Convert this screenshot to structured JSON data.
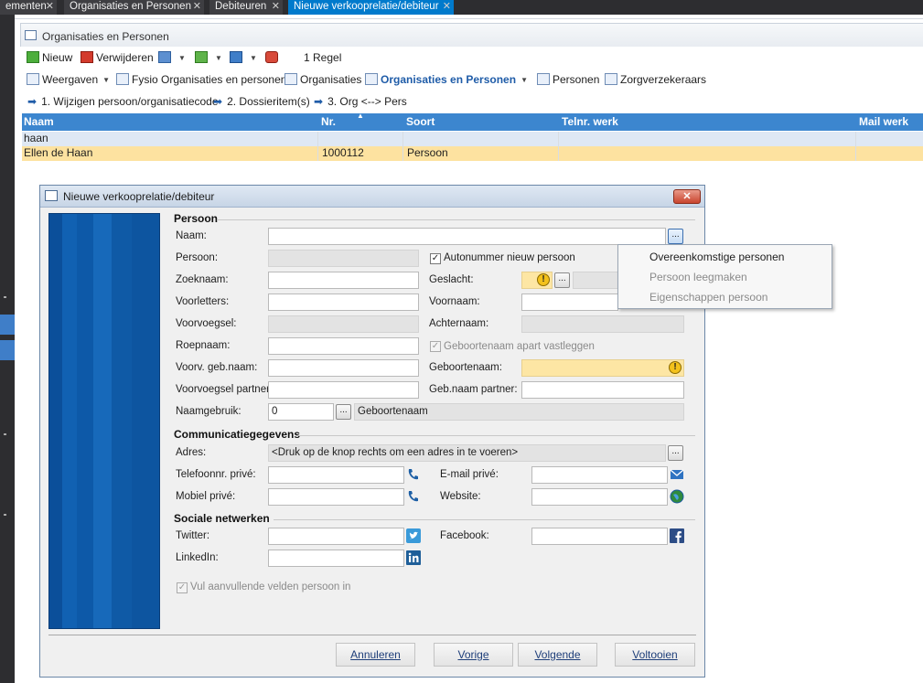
{
  "tabs": [
    {
      "label": "ementen"
    },
    {
      "label": "Organisaties en Personen"
    },
    {
      "label": "Debiteuren"
    },
    {
      "label": "Nieuwe verkooprelatie/debiteur",
      "active": true
    }
  ],
  "panel": {
    "title": "Organisaties en Personen",
    "toolbar1": {
      "new": "Nieuw",
      "delete": "Verwijderen",
      "count": "1 Regel"
    },
    "toolbar2": {
      "views": "Weergaven",
      "fysio": "Fysio  Organisaties en personen",
      "organisaties": "Organisaties",
      "org_personen": "Organisaties en Personen",
      "personen": "Personen",
      "zorg": "Zorgverzekeraars"
    },
    "toolbar3": {
      "action1": "1. Wijzigen persoon/organisatiecode",
      "action2": "2. Dossieritem(s)",
      "action3": "3. Org <--> Pers"
    }
  },
  "grid": {
    "columns": [
      "Naam",
      "Nr.",
      "Soort",
      "Telnr. werk",
      "Mail werk"
    ],
    "filter_row": [
      "haan",
      "",
      "",
      "",
      ""
    ],
    "rows": [
      [
        "Ellen de Haan",
        "1000112",
        "Persoon",
        "",
        ""
      ]
    ]
  },
  "dialog": {
    "title": "Nieuwe verkooprelatie/debiteur",
    "persoon_section": "Persoon",
    "labels": {
      "naam": "Naam:",
      "persoon": "Persoon:",
      "zoeknaam": "Zoeknaam:",
      "voorletters": "Voorletters:",
      "voorvoegsel": "Voorvoegsel:",
      "roepnaam": "Roepnaam:",
      "voorv_geb": "Voorv. geb.naam:",
      "voorv_partner": "Voorvoegsel partner:",
      "naamgebruik": "Naamgebruik:",
      "autonummer": "Autonummer nieuw persoon",
      "geslacht": "Geslacht:",
      "voornaam": "Voornaam:",
      "achternaam": "Achternaam:",
      "geb_apart": "Geboortenaam apart vastleggen",
      "geboortenaam": "Geboortenaam:",
      "geb_partner": "Geb.naam partner:"
    },
    "values": {
      "naamgebruik": "0",
      "naamgebruik_desc": "Geboortenaam"
    },
    "comm_section": "Communicatiegegevens",
    "comm": {
      "adres": "Adres:",
      "adres_placeholder": "<Druk op de knop rechts om een adres in te voeren>",
      "tel_prive": "Telefoonnr. privé:",
      "mobiel": "Mobiel privé:",
      "email": "E-mail privé:",
      "website": "Website:"
    },
    "social_section": "Sociale netwerken",
    "social": {
      "twitter": "Twitter:",
      "facebook": "Facebook:",
      "linkedin": "LinkedIn:"
    },
    "extra_checkbox": "Vul aanvullende velden persoon in",
    "buttons": {
      "annuleren": "Annuleren",
      "vorige": "Vorige",
      "volgende": "Volgende",
      "voltooien": "Voltooien"
    }
  },
  "context_menu": {
    "items": [
      {
        "label": "Overeenkomstige personen",
        "enabled": true
      },
      {
        "label": "Persoon leegmaken",
        "enabled": false
      },
      {
        "label": "Eigenschappen persoon",
        "enabled": false
      }
    ]
  },
  "colors": {
    "accent_blue": "#3c86cf",
    "selected_row": "#fde2a0",
    "warning_field": "#fde6a4",
    "tab_active": "#007acc"
  }
}
